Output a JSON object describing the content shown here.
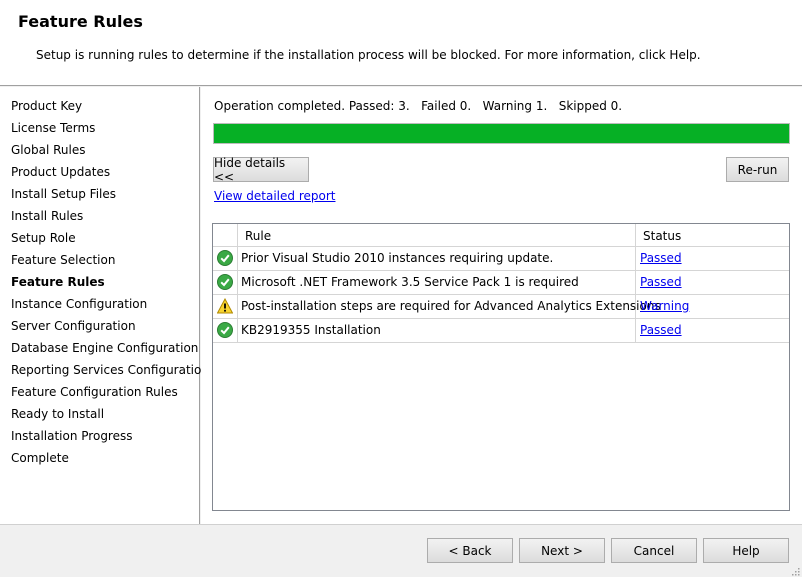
{
  "header": {
    "title": "Feature Rules",
    "description": "Setup is running rules to determine if the installation process will be blocked. For more information, click Help."
  },
  "sidebar": {
    "items": [
      {
        "label": "Product Key"
      },
      {
        "label": "License Terms"
      },
      {
        "label": "Global Rules"
      },
      {
        "label": "Product Updates"
      },
      {
        "label": "Install Setup Files"
      },
      {
        "label": "Install Rules"
      },
      {
        "label": "Setup Role"
      },
      {
        "label": "Feature Selection"
      },
      {
        "label": "Feature Rules",
        "active": true
      },
      {
        "label": "Instance Configuration"
      },
      {
        "label": "Server Configuration"
      },
      {
        "label": "Database Engine Configuration"
      },
      {
        "label": "Reporting Services Configuration"
      },
      {
        "label": "Feature Configuration Rules"
      },
      {
        "label": "Ready to Install"
      },
      {
        "label": "Installation Progress"
      },
      {
        "label": "Complete"
      }
    ]
  },
  "main": {
    "status_text": "Operation completed. Passed: 3.   Failed 0.   Warning 1.   Skipped 0.",
    "progress_percent": 100,
    "progress_color": "#06b025",
    "hide_details_label": "Hide details <<",
    "rerun_label": "Re-run",
    "report_link": "View detailed report",
    "grid": {
      "columns": [
        "Rule",
        "Status"
      ],
      "rows": [
        {
          "icon": "check-circle-icon",
          "rule": "Prior Visual Studio 2010 instances requiring update.",
          "status": "Passed"
        },
        {
          "icon": "check-circle-icon",
          "rule": "Microsoft .NET Framework 3.5 Service Pack 1 is required",
          "status": "Passed"
        },
        {
          "icon": "warning-triangle-icon",
          "rule": "Post-installation steps are required for Advanced Analytics Extensions",
          "status": "Warning"
        },
        {
          "icon": "check-circle-icon",
          "rule": "KB2919355 Installation",
          "status": "Passed"
        }
      ]
    }
  },
  "footer": {
    "back_label": "< Back",
    "next_label": "Next >",
    "cancel_label": "Cancel",
    "help_label": "Help"
  }
}
